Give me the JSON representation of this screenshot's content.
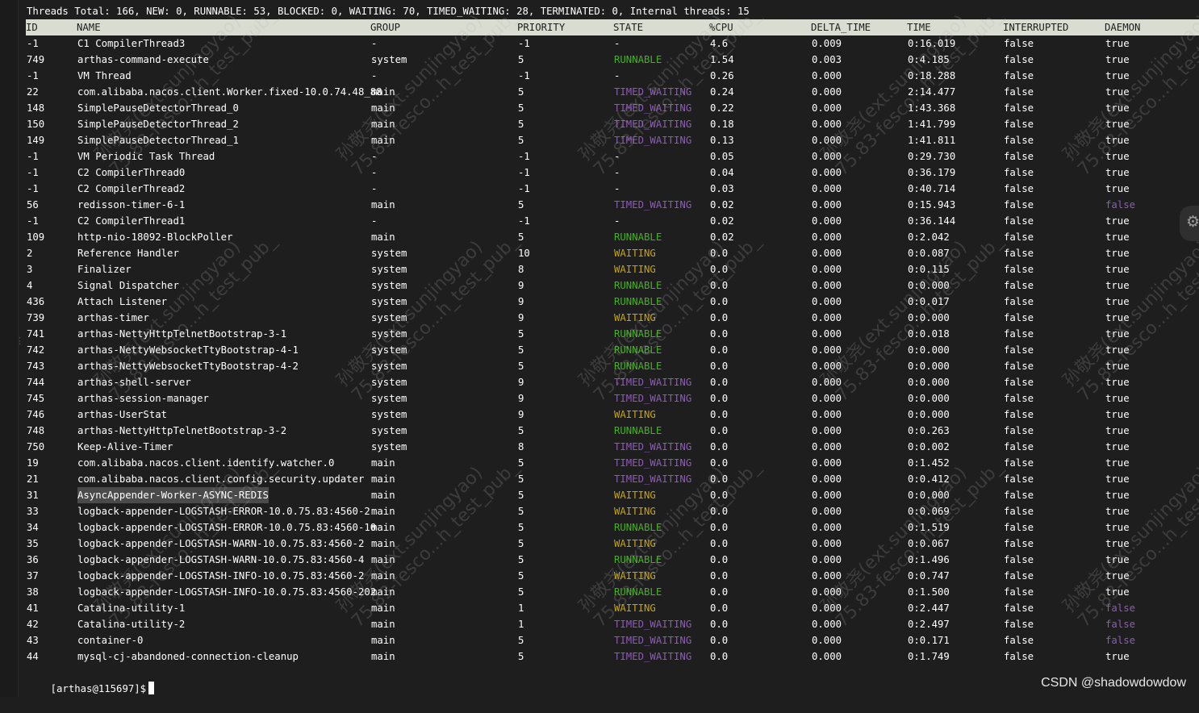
{
  "summary": "Threads Total: 166, NEW: 0, RUNNABLE: 53, BLOCKED: 0, WAITING: 70, TIMED_WAITING: 28, TERMINATED: 0, Internal threads: 15",
  "columns": [
    "ID",
    "NAME",
    "GROUP",
    "PRIORITY",
    "STATE",
    "%CPU",
    "DELTA_TIME",
    "TIME",
    "INTERRUPTED",
    "DAEMON"
  ],
  "rows": [
    [
      "-1",
      "C1 CompilerThread3",
      "-",
      "-1",
      "-",
      "4.6",
      "0.009",
      "0:16.019",
      "false",
      "true"
    ],
    [
      "749",
      "arthas-command-execute",
      "system",
      "5",
      "RUNNABLE",
      "1.54",
      "0.003",
      "0:4.185",
      "false",
      "true"
    ],
    [
      "-1",
      "VM Thread",
      "-",
      "-1",
      "-",
      "0.26",
      "0.000",
      "0:18.288",
      "false",
      "true"
    ],
    [
      "22",
      "com.alibaba.nacos.client.Worker.fixed-10.0.74.48_88",
      "main",
      "5",
      "TIMED_WAITING",
      "0.24",
      "0.000",
      "2:14.477",
      "false",
      "true"
    ],
    [
      "148",
      "SimplePauseDetectorThread_0",
      "main",
      "5",
      "TIMED_WAITING",
      "0.22",
      "0.000",
      "1:43.368",
      "false",
      "true"
    ],
    [
      "150",
      "SimplePauseDetectorThread_2",
      "main",
      "5",
      "TIMED_WAITING",
      "0.18",
      "0.000",
      "1:41.799",
      "false",
      "true"
    ],
    [
      "149",
      "SimplePauseDetectorThread_1",
      "main",
      "5",
      "TIMED_WAITING",
      "0.13",
      "0.000",
      "1:41.811",
      "false",
      "true"
    ],
    [
      "-1",
      "VM Periodic Task Thread",
      "-",
      "-1",
      "-",
      "0.05",
      "0.000",
      "0:29.730",
      "false",
      "true"
    ],
    [
      "-1",
      "C2 CompilerThread0",
      "-",
      "-1",
      "-",
      "0.04",
      "0.000",
      "0:36.179",
      "false",
      "true"
    ],
    [
      "-1",
      "C2 CompilerThread2",
      "-",
      "-1",
      "-",
      "0.03",
      "0.000",
      "0:40.714",
      "false",
      "true"
    ],
    [
      "56",
      "redisson-timer-6-1",
      "main",
      "5",
      "TIMED_WAITING",
      "0.02",
      "0.000",
      "0:15.943",
      "false",
      "false"
    ],
    [
      "-1",
      "C2 CompilerThread1",
      "-",
      "-1",
      "-",
      "0.02",
      "0.000",
      "0:36.144",
      "false",
      "true"
    ],
    [
      "109",
      "http-nio-18092-BlockPoller",
      "main",
      "5",
      "RUNNABLE",
      "0.02",
      "0.000",
      "0:2.042",
      "false",
      "true"
    ],
    [
      "2",
      "Reference Handler",
      "system",
      "10",
      "WAITING",
      "0.0",
      "0.000",
      "0:0.087",
      "false",
      "true"
    ],
    [
      "3",
      "Finalizer",
      "system",
      "8",
      "WAITING",
      "0.0",
      "0.000",
      "0:0.115",
      "false",
      "true"
    ],
    [
      "4",
      "Signal Dispatcher",
      "system",
      "9",
      "RUNNABLE",
      "0.0",
      "0.000",
      "0:0.000",
      "false",
      "true"
    ],
    [
      "436",
      "Attach Listener",
      "system",
      "9",
      "RUNNABLE",
      "0.0",
      "0.000",
      "0:0.017",
      "false",
      "true"
    ],
    [
      "739",
      "arthas-timer",
      "system",
      "9",
      "WAITING",
      "0.0",
      "0.000",
      "0:0.000",
      "false",
      "true"
    ],
    [
      "741",
      "arthas-NettyHttpTelnetBootstrap-3-1",
      "system",
      "5",
      "RUNNABLE",
      "0.0",
      "0.000",
      "0:0.018",
      "false",
      "true"
    ],
    [
      "742",
      "arthas-NettyWebsocketTtyBootstrap-4-1",
      "system",
      "5",
      "RUNNABLE",
      "0.0",
      "0.000",
      "0:0.000",
      "false",
      "true"
    ],
    [
      "743",
      "arthas-NettyWebsocketTtyBootstrap-4-2",
      "system",
      "5",
      "RUNNABLE",
      "0.0",
      "0.000",
      "0:0.000",
      "false",
      "true"
    ],
    [
      "744",
      "arthas-shell-server",
      "system",
      "9",
      "TIMED_WAITING",
      "0.0",
      "0.000",
      "0:0.000",
      "false",
      "true"
    ],
    [
      "745",
      "arthas-session-manager",
      "system",
      "9",
      "TIMED_WAITING",
      "0.0",
      "0.000",
      "0:0.000",
      "false",
      "true"
    ],
    [
      "746",
      "arthas-UserStat",
      "system",
      "9",
      "WAITING",
      "0.0",
      "0.000",
      "0:0.000",
      "false",
      "true"
    ],
    [
      "748",
      "arthas-NettyHttpTelnetBootstrap-3-2",
      "system",
      "5",
      "RUNNABLE",
      "0.0",
      "0.000",
      "0:0.263",
      "false",
      "true"
    ],
    [
      "750",
      "Keep-Alive-Timer",
      "system",
      "8",
      "TIMED_WAITING",
      "0.0",
      "0.000",
      "0:0.002",
      "false",
      "true"
    ],
    [
      "19",
      "com.alibaba.nacos.client.identify.watcher.0",
      "main",
      "5",
      "TIMED_WAITING",
      "0.0",
      "0.000",
      "0:1.452",
      "false",
      "true"
    ],
    [
      "21",
      "com.alibaba.nacos.client.config.security.updater",
      "main",
      "5",
      "TIMED_WAITING",
      "0.0",
      "0.000",
      "0:0.412",
      "false",
      "true"
    ],
    [
      "31",
      "AsyncAppender-Worker-ASYNC-REDIS",
      "main",
      "5",
      "WAITING",
      "0.0",
      "0.000",
      "0:0.000",
      "false",
      "true"
    ],
    [
      "33",
      "logback-appender-LOGSTASH-ERROR-10.0.75.83:4560-2",
      "main",
      "5",
      "WAITING",
      "0.0",
      "0.000",
      "0:0.069",
      "false",
      "true"
    ],
    [
      "34",
      "logback-appender-LOGSTASH-ERROR-10.0.75.83:4560-10",
      "main",
      "5",
      "RUNNABLE",
      "0.0",
      "0.000",
      "0:1.519",
      "false",
      "true"
    ],
    [
      "35",
      "logback-appender-LOGSTASH-WARN-10.0.75.83:4560-2",
      "main",
      "5",
      "WAITING",
      "0.0",
      "0.000",
      "0:0.067",
      "false",
      "true"
    ],
    [
      "36",
      "logback-appender-LOGSTASH-WARN-10.0.75.83:4560-4",
      "main",
      "5",
      "RUNNABLE",
      "0.0",
      "0.000",
      "0:1.496",
      "false",
      "true"
    ],
    [
      "37",
      "logback-appender-LOGSTASH-INFO-10.0.75.83:4560-2",
      "main",
      "5",
      "WAITING",
      "0.0",
      "0.000",
      "0:0.747",
      "false",
      "true"
    ],
    [
      "38",
      "logback-appender-LOGSTASH-INFO-10.0.75.83:4560-202",
      "main",
      "5",
      "RUNNABLE",
      "0.0",
      "0.000",
      "0:1.500",
      "false",
      "true"
    ],
    [
      "41",
      "Catalina-utility-1",
      "main",
      "1",
      "WAITING",
      "0.0",
      "0.000",
      "0:2.447",
      "false",
      "false"
    ],
    [
      "42",
      "Catalina-utility-2",
      "main",
      "1",
      "TIMED_WAITING",
      "0.0",
      "0.000",
      "0:2.497",
      "false",
      "false"
    ],
    [
      "43",
      "container-0",
      "main",
      "5",
      "TIMED_WAITING",
      "0.0",
      "0.000",
      "0:0.171",
      "false",
      "false"
    ],
    [
      "44",
      "mysql-cj-abandoned-connection-cleanup",
      "main",
      "5",
      "TIMED_WAITING",
      "0.0",
      "0.000",
      "0:1.749",
      "false",
      "true"
    ]
  ],
  "prompt": "[arthas@115697]$",
  "watermark": {
    "name_text": "孙敬尧(ext.sunjingyao)",
    "code_text": "75.83-fesco...h_test_pub_"
  },
  "credit": "CSDN @shadowdowdow",
  "colors": {
    "background": "#1e1e1e",
    "header_bg": "#d9dcd0",
    "runnable": "#3fb618",
    "waiting": "#c7a400",
    "timed_waiting": "#8d5bb5"
  },
  "icons": {
    "settings_tab": "gear-icon"
  }
}
